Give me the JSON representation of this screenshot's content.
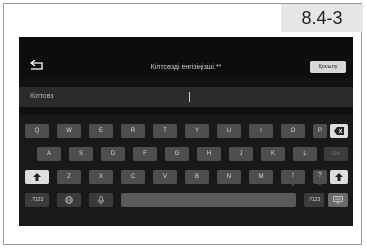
{
  "page_label": "8.4-3",
  "header": {
    "prompt": "Кілтсөзді енгізіңізші.**",
    "connect_label": "Қосылу"
  },
  "input": {
    "label": "Кілтсөз"
  },
  "keyboard": {
    "row1": [
      "Q",
      "W",
      "E",
      "R",
      "T",
      "Y",
      "U",
      "I",
      "O",
      "P"
    ],
    "row2": [
      "A",
      "S",
      "D",
      "F",
      "G",
      "H",
      "J",
      "K",
      "L"
    ],
    "go_label": "Go",
    "row3": [
      "Z",
      "X",
      "C",
      "V",
      "B",
      "N",
      "M",
      "!\n,",
      "?\n."
    ],
    "sym_left": ".?123",
    "sym_right": ".?123"
  },
  "icons": {
    "back": "back-arrow-icon",
    "backspace": "backspace-icon",
    "shift": "shift-icon",
    "globe": "globe-icon",
    "mic": "microphone-icon",
    "hide": "keyboard-hide-icon"
  }
}
